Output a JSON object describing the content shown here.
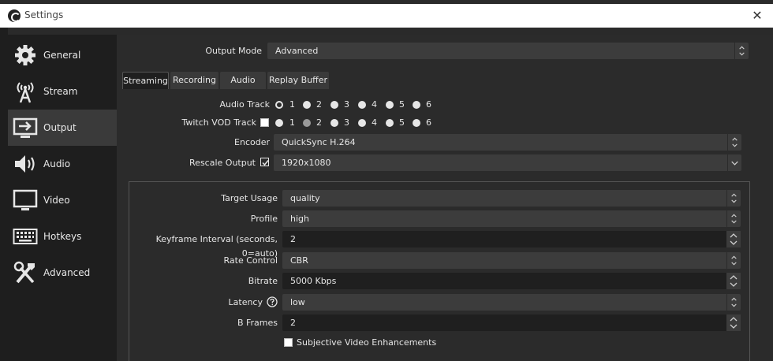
{
  "window": {
    "title": "Settings",
    "close_glyph": "✕"
  },
  "sidebar": {
    "items": [
      {
        "label": "General",
        "icon": "gear-icon"
      },
      {
        "label": "Stream",
        "icon": "antenna-icon"
      },
      {
        "label": "Output",
        "icon": "output-monitor-icon",
        "active": true
      },
      {
        "label": "Audio",
        "icon": "speaker-icon"
      },
      {
        "label": "Video",
        "icon": "monitor-icon"
      },
      {
        "label": "Hotkeys",
        "icon": "keyboard-icon"
      },
      {
        "label": "Advanced",
        "icon": "tools-icon"
      }
    ]
  },
  "output_mode": {
    "label": "Output Mode",
    "value": "Advanced"
  },
  "tabs": [
    {
      "label": "Streaming",
      "active": true
    },
    {
      "label": "Recording"
    },
    {
      "label": "Audio"
    },
    {
      "label": "Replay Buffer"
    }
  ],
  "audio_track": {
    "label": "Audio Track",
    "options": [
      "1",
      "2",
      "3",
      "4",
      "5",
      "6"
    ],
    "selected": "1"
  },
  "twitch_vod": {
    "label": "Twitch VOD Track",
    "checked": false,
    "options": [
      "1",
      "2",
      "3",
      "4",
      "5",
      "6"
    ],
    "selected": "2"
  },
  "encoder": {
    "label": "Encoder",
    "value": "QuickSync H.264"
  },
  "rescale": {
    "label": "Rescale Output",
    "checked": true,
    "value": "1920x1080"
  },
  "settings": {
    "target_usage": {
      "label": "Target Usage",
      "value": "quality"
    },
    "profile": {
      "label": "Profile",
      "value": "high"
    },
    "keyframe": {
      "label": "Keyframe Interval (seconds, 0=auto)",
      "value": "2"
    },
    "rate_control": {
      "label": "Rate Control",
      "value": "CBR"
    },
    "bitrate": {
      "label": "Bitrate",
      "value": "5000 Kbps"
    },
    "latency": {
      "label": "Latency",
      "value": "low"
    },
    "bframes": {
      "label": "B Frames",
      "value": "2"
    },
    "subjective": {
      "label": "Subjective Video Enhancements",
      "checked": false
    }
  },
  "colors": {
    "accent_bg": "#3a3a3a",
    "panel_bg": "#2b2b2b",
    "sidebar_bg": "#1e1e1e"
  }
}
